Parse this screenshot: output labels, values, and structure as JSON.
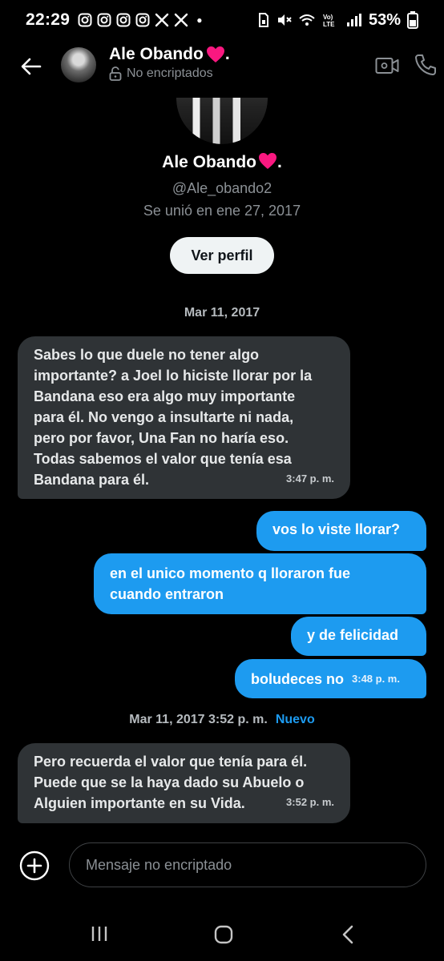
{
  "status_bar": {
    "time": "22:29",
    "battery": "53%",
    "notification_icons": [
      "instagram-icon",
      "instagram-icon",
      "instagram-icon",
      "instagram-icon",
      "x-icon",
      "x-icon"
    ],
    "network": "Vo) LTE"
  },
  "header": {
    "name": "Ale Obando",
    "name_suffix": ".",
    "encryption_status": "No encriptados"
  },
  "profile": {
    "name": "Ale Obando",
    "name_suffix": ".",
    "handle": "@Ale_obando2",
    "joined": "Se unió en ene 27, 2017",
    "view_profile_label": "Ver perfil"
  },
  "conversation": {
    "date_1": "Mar 11, 2017",
    "messages_1": [
      {
        "direction": "received",
        "text": "Sabes lo que duele no tener algo\nimportante? a Joel lo hiciste llorar por la\nBandana eso era algo muy importante\npara él. No vengo a insultarte ni nada,\npero por favor, Una Fan no haría eso.\nTodas sabemos el valor que tenía esa\nBandana para él.",
        "time": "3:47 p. m."
      },
      {
        "direction": "sent",
        "text": "vos lo viste llorar?"
      },
      {
        "direction": "sent",
        "text": "en el unico momento q lloraron fue\ncuando entraron"
      },
      {
        "direction": "sent",
        "text": "y de felicidad"
      },
      {
        "direction": "sent",
        "text": "boludeces no",
        "time": "3:48 p. m."
      }
    ],
    "date_2": "Mar 11, 2017 3:52 p. m.",
    "new_label": "Nuevo",
    "messages_2": [
      {
        "direction": "received",
        "text": "Pero recuerda el valor que tenía para él.\nPuede que se la haya dado su Abuelo o\nAlguien importante en su Vida.",
        "time": "3:52 p. m."
      }
    ]
  },
  "composer": {
    "placeholder": "Mensaje no encriptado"
  },
  "colors": {
    "background": "#000000",
    "sent_bubble": "#1d9bf0",
    "received_bubble": "#2f3336",
    "heart": "#f91880",
    "accent": "#1d9bf0"
  }
}
